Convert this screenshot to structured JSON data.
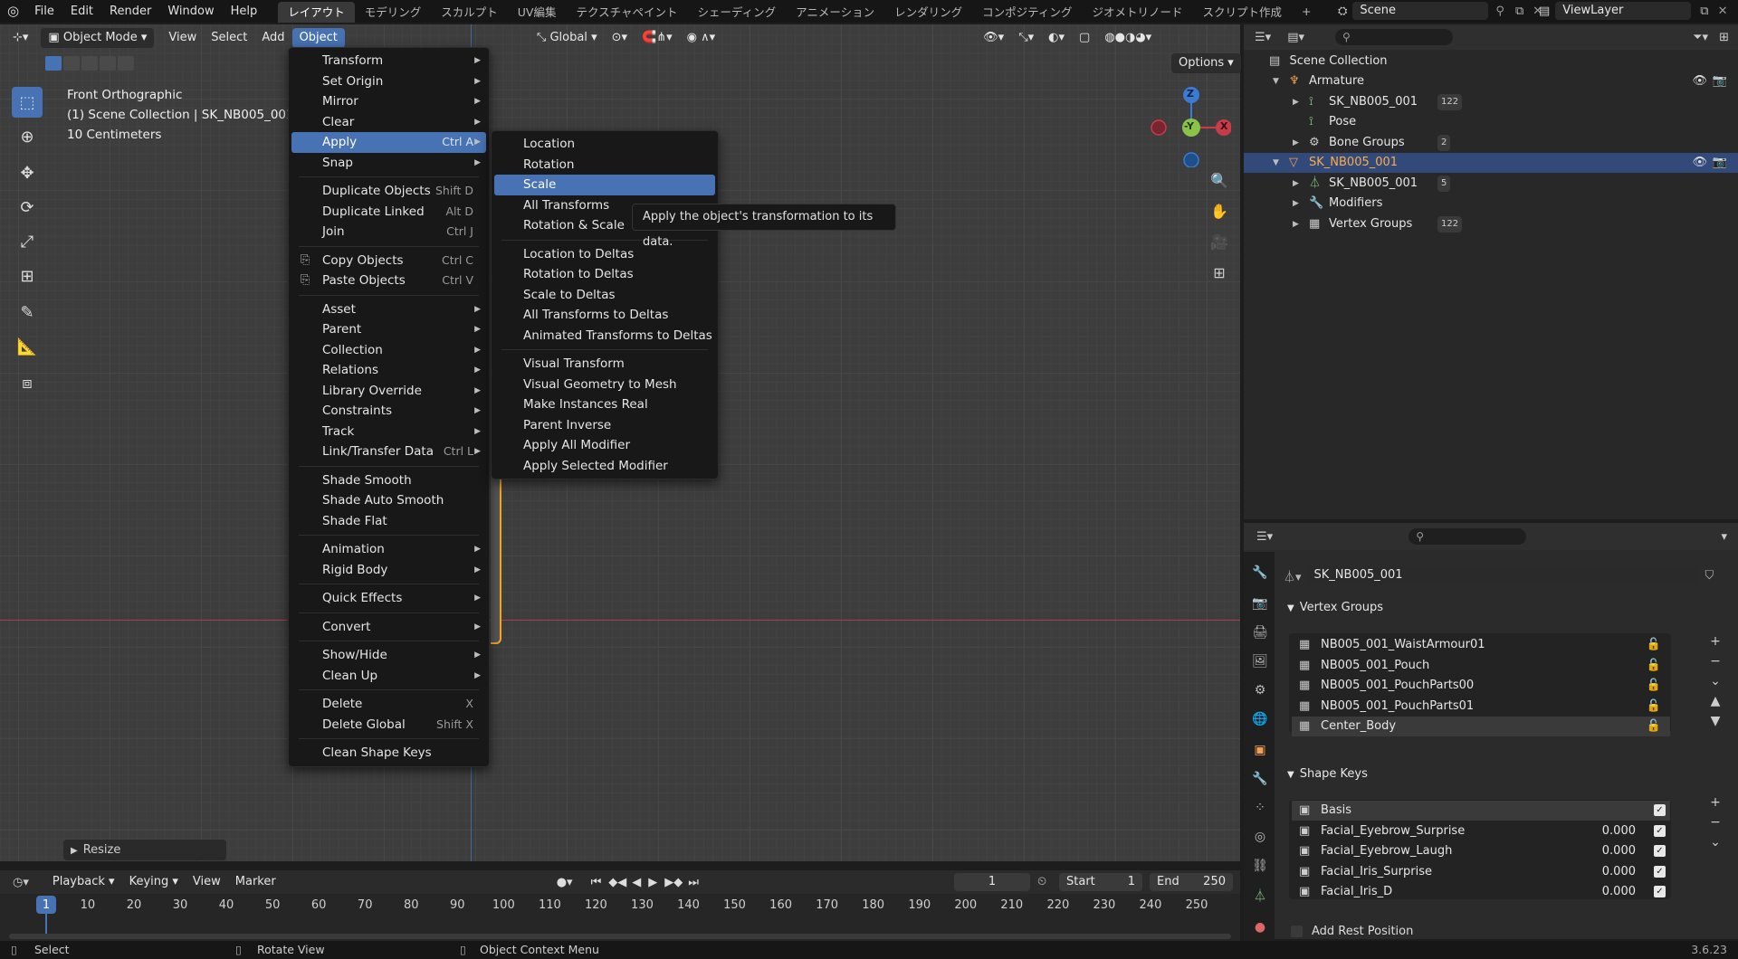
{
  "topbar": {
    "menus": [
      "File",
      "Edit",
      "Render",
      "Window",
      "Help"
    ],
    "workspaces": [
      "レイアウト",
      "モデリング",
      "スカルプト",
      "UV編集",
      "テクスチャペイント",
      "シェーディング",
      "アニメーション",
      "レンダリング",
      "コンポジティング",
      "ジオメトリノード",
      "スクリプト作成"
    ],
    "add_tab": "+",
    "scene_label": "Scene",
    "viewlayer_label": "ViewLayer"
  },
  "viewport_header": {
    "mode": "Object Mode",
    "menus": [
      "View",
      "Select",
      "Add",
      "Object"
    ],
    "active_menu": "Object",
    "orientation": "Global",
    "options": "Options"
  },
  "viewport_info": {
    "line1": "Front Orthographic",
    "line2": "(1) Scene Collection | SK_NB005_001",
    "line3": "10 Centimeters"
  },
  "gizmo": {
    "z": "Z",
    "y": "-Y",
    "x": "X"
  },
  "object_menu": {
    "groups": [
      [
        {
          "label": "Transform",
          "shortcut": "",
          "sub": true
        },
        {
          "label": "Set Origin",
          "shortcut": "",
          "sub": true
        },
        {
          "label": "Mirror",
          "shortcut": "",
          "sub": true
        },
        {
          "label": "Clear",
          "shortcut": "",
          "sub": true
        },
        {
          "label": "Apply",
          "shortcut": "Ctrl A",
          "sub": true,
          "highlight": true
        },
        {
          "label": "Snap",
          "shortcut": "",
          "sub": true
        }
      ],
      [
        {
          "label": "Duplicate Objects",
          "shortcut": "Shift D"
        },
        {
          "label": "Duplicate Linked",
          "shortcut": "Alt D"
        },
        {
          "label": "Join",
          "shortcut": "Ctrl J"
        }
      ],
      [
        {
          "label": "Copy Objects",
          "shortcut": "Ctrl C",
          "icon": "copy"
        },
        {
          "label": "Paste Objects",
          "shortcut": "Ctrl V",
          "icon": "paste"
        }
      ],
      [
        {
          "label": "Asset",
          "shortcut": "",
          "sub": true
        },
        {
          "label": "Parent",
          "shortcut": "",
          "sub": true
        },
        {
          "label": "Collection",
          "shortcut": "",
          "sub": true
        },
        {
          "label": "Relations",
          "shortcut": "",
          "sub": true
        },
        {
          "label": "Library Override",
          "shortcut": "",
          "sub": true
        },
        {
          "label": "Constraints",
          "shortcut": "",
          "sub": true
        },
        {
          "label": "Track",
          "shortcut": "",
          "sub": true
        },
        {
          "label": "Link/Transfer Data",
          "shortcut": "Ctrl L",
          "sub": true
        }
      ],
      [
        {
          "label": "Shade Smooth",
          "shortcut": ""
        },
        {
          "label": "Shade Auto Smooth",
          "shortcut": ""
        },
        {
          "label": "Shade Flat",
          "shortcut": ""
        }
      ],
      [
        {
          "label": "Animation",
          "shortcut": "",
          "sub": true
        },
        {
          "label": "Rigid Body",
          "shortcut": "",
          "sub": true
        }
      ],
      [
        {
          "label": "Quick Effects",
          "shortcut": "",
          "sub": true
        }
      ],
      [
        {
          "label": "Convert",
          "shortcut": "",
          "sub": true
        }
      ],
      [
        {
          "label": "Show/Hide",
          "shortcut": "",
          "sub": true
        },
        {
          "label": "Clean Up",
          "shortcut": "",
          "sub": true
        }
      ],
      [
        {
          "label": "Delete",
          "shortcut": "X"
        },
        {
          "label": "Delete Global",
          "shortcut": "Shift X"
        }
      ],
      [
        {
          "label": "Clean Shape Keys",
          "shortcut": ""
        }
      ]
    ]
  },
  "apply_menu": {
    "groups": [
      [
        "Location",
        "Rotation",
        "Scale",
        "All Transforms",
        "Rotation & Scale"
      ],
      [
        "Location to Deltas",
        "Rotation to Deltas",
        "Scale to Deltas",
        "All Transforms to Deltas",
        "Animated Transforms to Deltas"
      ],
      [
        "Visual Transform",
        "Visual Geometry to Mesh",
        "Make Instances Real",
        "Parent Inverse",
        "Apply All Modifier",
        "Apply Selected Modifier"
      ]
    ],
    "highlighted": "Scale"
  },
  "tooltip": "Apply the object's transformation to its data.",
  "resize_panel": "Resize",
  "outliner": {
    "root": "Scene Collection",
    "rows": [
      {
        "label": "Armature",
        "indent": 1,
        "icon": "armature-icon",
        "expand": "▼",
        "eye": true
      },
      {
        "label": "SK_NB005_001",
        "indent": 2,
        "icon": "armature-data-icon",
        "expand": "▶",
        "badge": "122"
      },
      {
        "label": "Pose",
        "indent": 2,
        "icon": "pose-icon",
        "expand": ""
      },
      {
        "label": "Bone Groups",
        "indent": 2,
        "icon": "bone-groups-icon",
        "expand": "▶",
        "badge": "2"
      },
      {
        "label": "SK_NB005_001",
        "indent": 1,
        "icon": "mesh-object-icon",
        "expand": "▼",
        "eye": true,
        "selected": true
      },
      {
        "label": "SK_NB005_001",
        "indent": 2,
        "icon": "mesh-data-icon",
        "expand": "▶",
        "badge": "5"
      },
      {
        "label": "Modifiers",
        "indent": 2,
        "icon": "wrench-icon",
        "expand": "▶"
      },
      {
        "label": "Vertex Groups",
        "indent": 2,
        "icon": "vertex-groups-icon",
        "expand": "▶",
        "badge": "122"
      }
    ]
  },
  "properties": {
    "object_name": "SK_NB005_001",
    "vertex_groups_title": "Vertex Groups",
    "vertex_groups": [
      "NB005_001_WaistArmour01",
      "NB005_001_Pouch",
      "NB005_001_PouchParts00",
      "NB005_001_PouchParts01",
      "Center_Body"
    ],
    "shape_keys_title": "Shape Keys",
    "shape_keys": [
      {
        "name": "Basis",
        "value": ""
      },
      {
        "name": "Facial_Eyebrow_Surprise",
        "value": "0.000"
      },
      {
        "name": "Facial_Eyebrow_Laugh",
        "value": "0.000"
      },
      {
        "name": "Facial_Iris_Surprise",
        "value": "0.000"
      },
      {
        "name": "Facial_Iris_D",
        "value": "0.000"
      }
    ],
    "add_rest_position": "Add Rest Position"
  },
  "timeline": {
    "menus": [
      "Playback",
      "Keying",
      "View",
      "Marker"
    ],
    "current_frame": "1",
    "start_label": "Start",
    "start": "1",
    "end_label": "End",
    "end": "250",
    "ticks": [
      "1",
      "10",
      "20",
      "30",
      "40",
      "50",
      "60",
      "70",
      "80",
      "90",
      "100",
      "110",
      "120",
      "130",
      "140",
      "150",
      "160",
      "170",
      "180",
      "190",
      "200",
      "210",
      "220",
      "230",
      "240",
      "250"
    ]
  },
  "statusbar": {
    "select": "Select",
    "rotate": "Rotate View",
    "context": "Object Context Menu",
    "version": "3.6.23"
  },
  "colors": {
    "accent": "#4772b3",
    "selection_orange": "#f5a623",
    "x_axis": "#c83c4a",
    "y_axis": "#8bc34a",
    "z_axis": "#3a7bd5"
  }
}
